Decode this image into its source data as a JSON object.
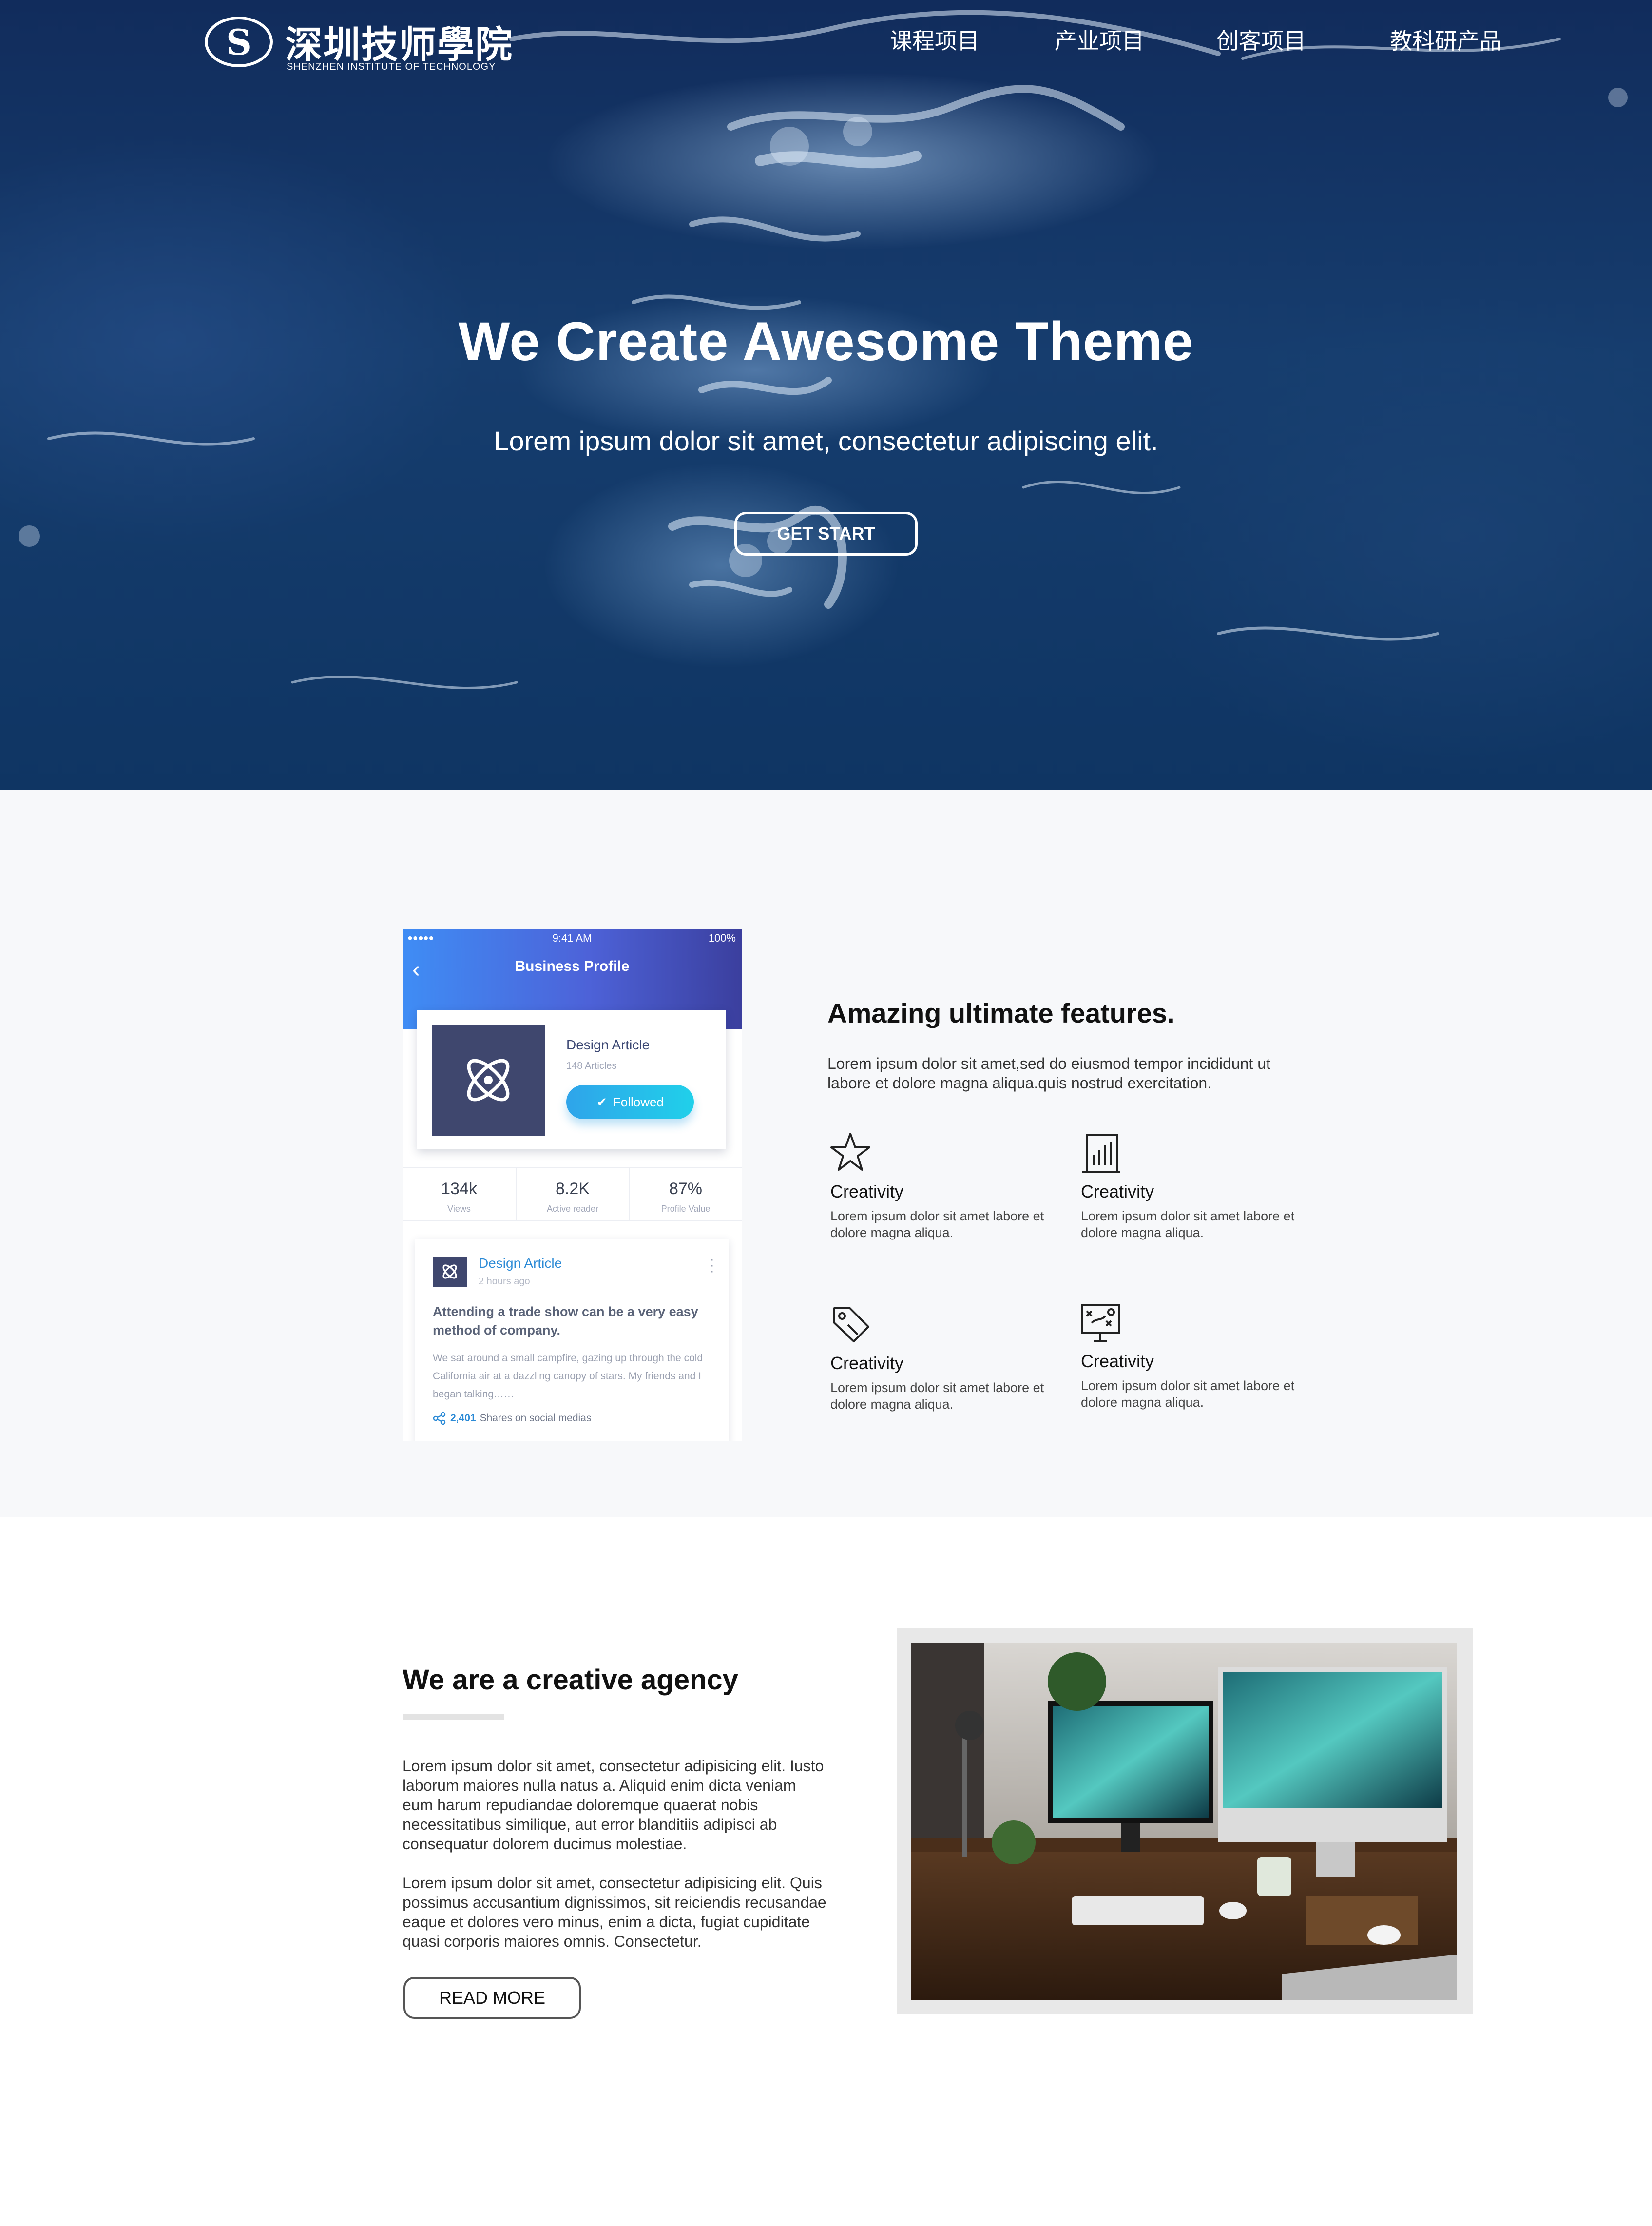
{
  "header": {
    "logo_letter": "S",
    "logo_cn": "深圳技师學院",
    "logo_en": "SHENZHEN INSTITUTE OF TECHNOLOGY",
    "nav": [
      "课程项目",
      "产业项目",
      "创客项目",
      "教科研产品"
    ]
  },
  "hero": {
    "title": "We Create Awesome Theme",
    "subtitle": "Lorem ipsum dolor sit amet, consectetur adipiscing elit.",
    "button": "GET START"
  },
  "phone": {
    "status_dots": "●●●●●",
    "time": "9:41 AM",
    "battery": "100%",
    "title": "Business Profile",
    "profile_name": "Design Article",
    "profile_count": "148 Articles",
    "follow_label": "Followed",
    "stats": [
      {
        "value": "134k",
        "label": "Views"
      },
      {
        "value": "8.2K",
        "label": "Active reader"
      },
      {
        "value": "87%",
        "label": "Profile Value"
      }
    ],
    "article": {
      "source": "Design Article",
      "time": "2 hours ago",
      "title": "Attending a trade show can be a very easy method of company.",
      "body": "We sat around a small campfire, gazing up through the cold California air at a dazzling canopy of stars. My friends and I began talking……",
      "shares_count": "2,401",
      "shares_label": "Shares on social medias"
    }
  },
  "features": {
    "title": "Amazing ultimate features.",
    "description": "Lorem ipsum dolor sit amet,sed do eiusmod tempor incididunt ut labore et dolore magna aliqua.quis nostrud exercitation.",
    "items": [
      {
        "icon": "star-icon",
        "name": "Creativity",
        "text": "Lorem ipsum dolor sit amet labore et dolore magna aliqua."
      },
      {
        "icon": "building-chart-icon",
        "name": "Creativity",
        "text": "Lorem ipsum dolor sit amet labore et dolore magna aliqua."
      },
      {
        "icon": "tag-icon",
        "name": "Creativity",
        "text": "Lorem ipsum dolor sit amet labore et dolore magna aliqua."
      },
      {
        "icon": "strategy-board-icon",
        "name": "Creativity",
        "text": "Lorem ipsum dolor sit amet labore et dolore magna aliqua."
      }
    ]
  },
  "agency": {
    "title": "We are a creative agency",
    "para1": "Lorem ipsum dolor sit amet, consectetur adipisicing elit. Iusto laborum maiores nulla natus a. Aliquid enim dicta veniam eum harum repudiandae doloremque quaerat nobis necessitatibus similique, aut error blanditiis adipisci ab consequatur dolorem ducimus molestiae.",
    "para2": "Lorem ipsum dolor sit amet, consectetur adipisicing elit. Quis possimus accusantium dignissimos, sit reiciendis recusandae eaque et dolores vero minus, enim a dicta, fugiat cupiditate quasi corporis maiores omnis. Consectetur.",
    "button": "READ MORE"
  },
  "colors": {
    "hero_bg": "#163d6e",
    "phone_gradient_start": "#3f8df5",
    "phone_gradient_end": "#3b3f9e",
    "follow_button": "#20d0ea",
    "link_blue": "#2b8ad6",
    "section_bg": "#f7f8fa"
  }
}
